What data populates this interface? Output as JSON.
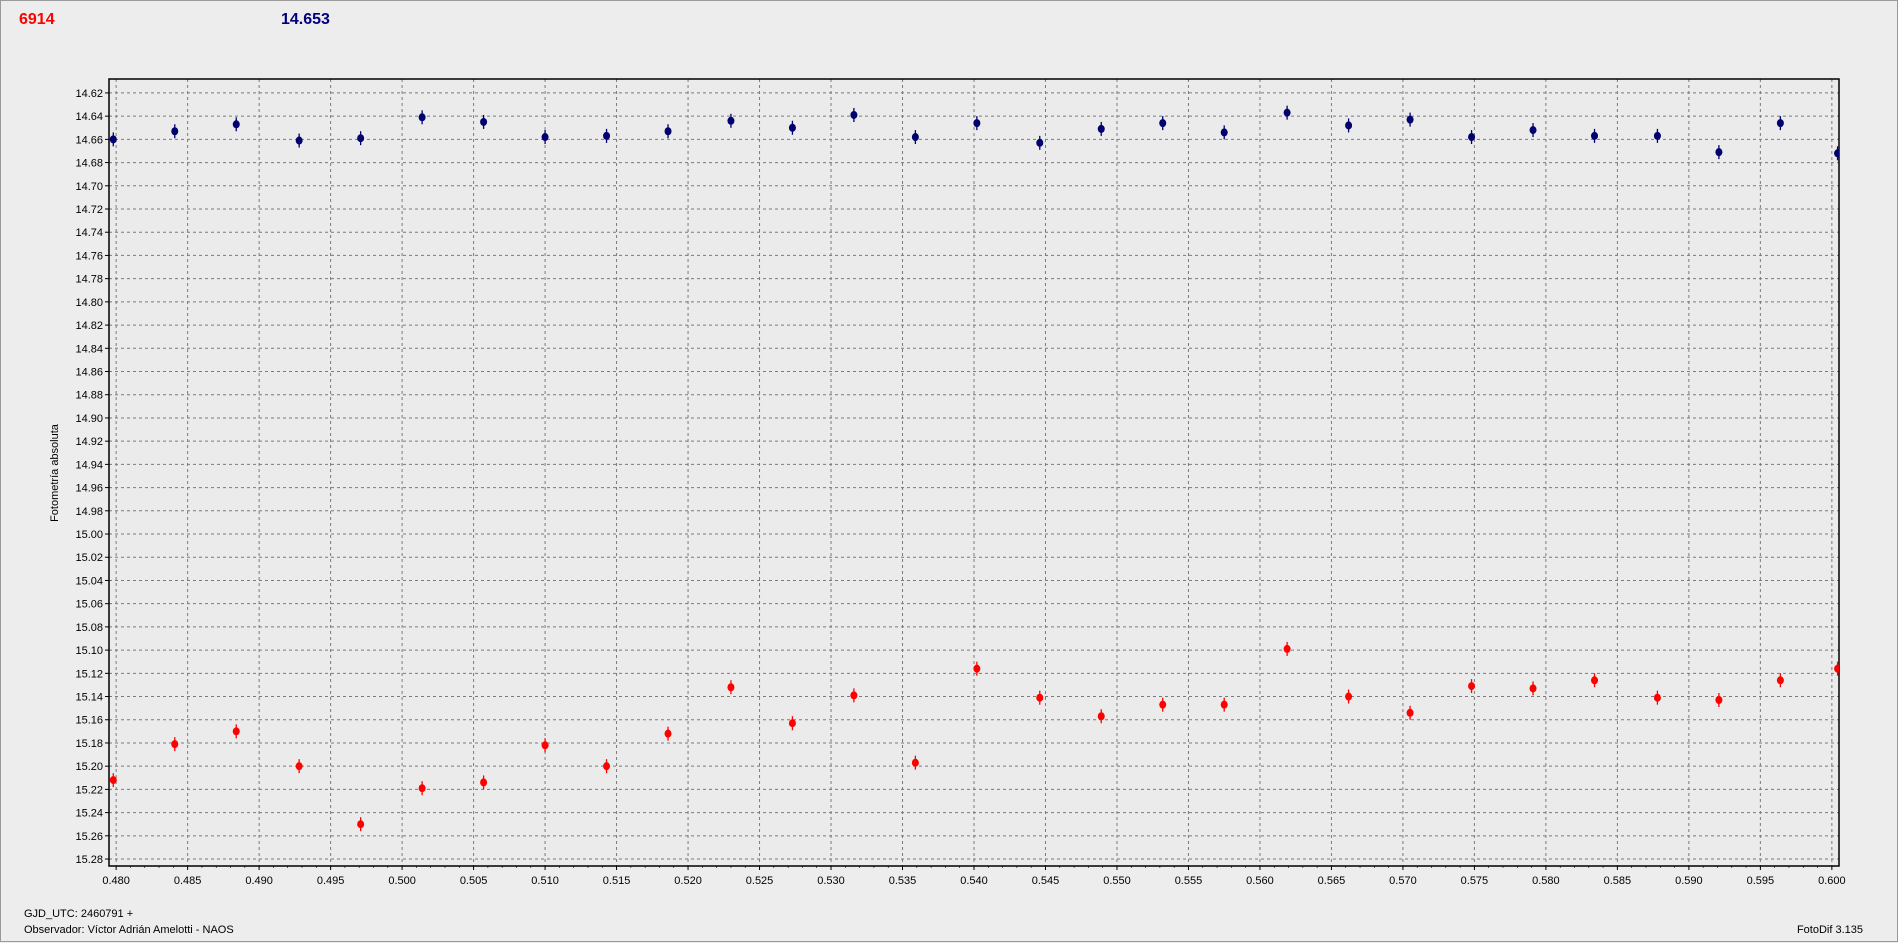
{
  "header": {
    "red_value": "6914",
    "blue_value": "14.653"
  },
  "footer": {
    "gjd": "GJD_UTC: 2460791 +",
    "observer": "Observador: Víctor Adrián Amelotti - NAOS",
    "app": "FotoDif 3.135"
  },
  "colors": {
    "series_blue": "#00006e",
    "series_red": "#ff0000",
    "plot_bg": "#ebebeb",
    "grid": "#7a7a7a"
  },
  "chart_data": {
    "type": "scatter",
    "title": "",
    "xlabel": "",
    "ylabel": "Fotometría absoluta",
    "xlim": [
      0.4795,
      0.6005
    ],
    "ylim": [
      14.608,
      15.286
    ],
    "y_inverted": true,
    "grid": true,
    "x_ticks": [
      "0.480",
      "0.485",
      "0.490",
      "0.495",
      "0.500",
      "0.505",
      "0.510",
      "0.515",
      "0.520",
      "0.525",
      "0.530",
      "0.535",
      "0.540",
      "0.545",
      "0.550",
      "0.555",
      "0.560",
      "0.565",
      "0.570",
      "0.575",
      "0.580",
      "0.585",
      "0.590",
      "0.595",
      "0.600"
    ],
    "y_ticks": [
      "14.62",
      "14.64",
      "14.66",
      "14.68",
      "14.70",
      "14.72",
      "14.74",
      "14.76",
      "14.78",
      "14.80",
      "14.82",
      "14.84",
      "14.86",
      "14.88",
      "14.90",
      "14.92",
      "14.94",
      "14.96",
      "14.98",
      "15.00",
      "15.02",
      "15.04",
      "15.06",
      "15.08",
      "15.10",
      "15.12",
      "15.14",
      "15.16",
      "15.18",
      "15.20",
      "15.22",
      "15.24",
      "15.26",
      "15.28"
    ],
    "series": [
      {
        "x": [
          0.4798,
          0.4841,
          0.4884,
          0.4928,
          0.4971,
          0.5014,
          0.5057,
          0.51,
          0.5143,
          0.5186,
          0.523,
          0.5273,
          0.5316,
          0.5359,
          0.5402,
          0.5446,
          0.5489,
          0.5532,
          0.5575,
          0.5619,
          0.5662,
          0.5705,
          0.5748,
          0.5791,
          0.5834,
          0.5878,
          0.5921,
          0.5964,
          0.6004
        ],
        "y": [
          14.66,
          14.653,
          14.647,
          14.661,
          14.659,
          14.641,
          14.645,
          14.658,
          14.657,
          14.653,
          14.644,
          14.65,
          14.639,
          14.658,
          14.646,
          14.663,
          14.651,
          14.646,
          14.654,
          14.637,
          14.648,
          14.643,
          14.658,
          14.652,
          14.657,
          14.657,
          14.671,
          14.646,
          14.672
        ]
      },
      {
        "x": [
          0.4798,
          0.4841,
          0.4884,
          0.4928,
          0.4971,
          0.5014,
          0.5057,
          0.51,
          0.5143,
          0.5186,
          0.523,
          0.5273,
          0.5316,
          0.5359,
          0.5402,
          0.5446,
          0.5489,
          0.5532,
          0.5575,
          0.5619,
          0.5662,
          0.5705,
          0.5748,
          0.5791,
          0.5834,
          0.5878,
          0.5921,
          0.5964,
          0.6004
        ],
        "y": [
          15.212,
          15.181,
          15.17,
          15.2,
          15.25,
          15.219,
          15.214,
          15.182,
          15.2,
          15.172,
          15.132,
          15.163,
          15.139,
          15.197,
          15.116,
          15.141,
          15.157,
          15.147,
          15.147,
          15.099,
          15.14,
          15.154,
          15.131,
          15.133,
          15.126,
          15.141,
          15.143,
          15.126,
          15.116
        ]
      }
    ]
  }
}
